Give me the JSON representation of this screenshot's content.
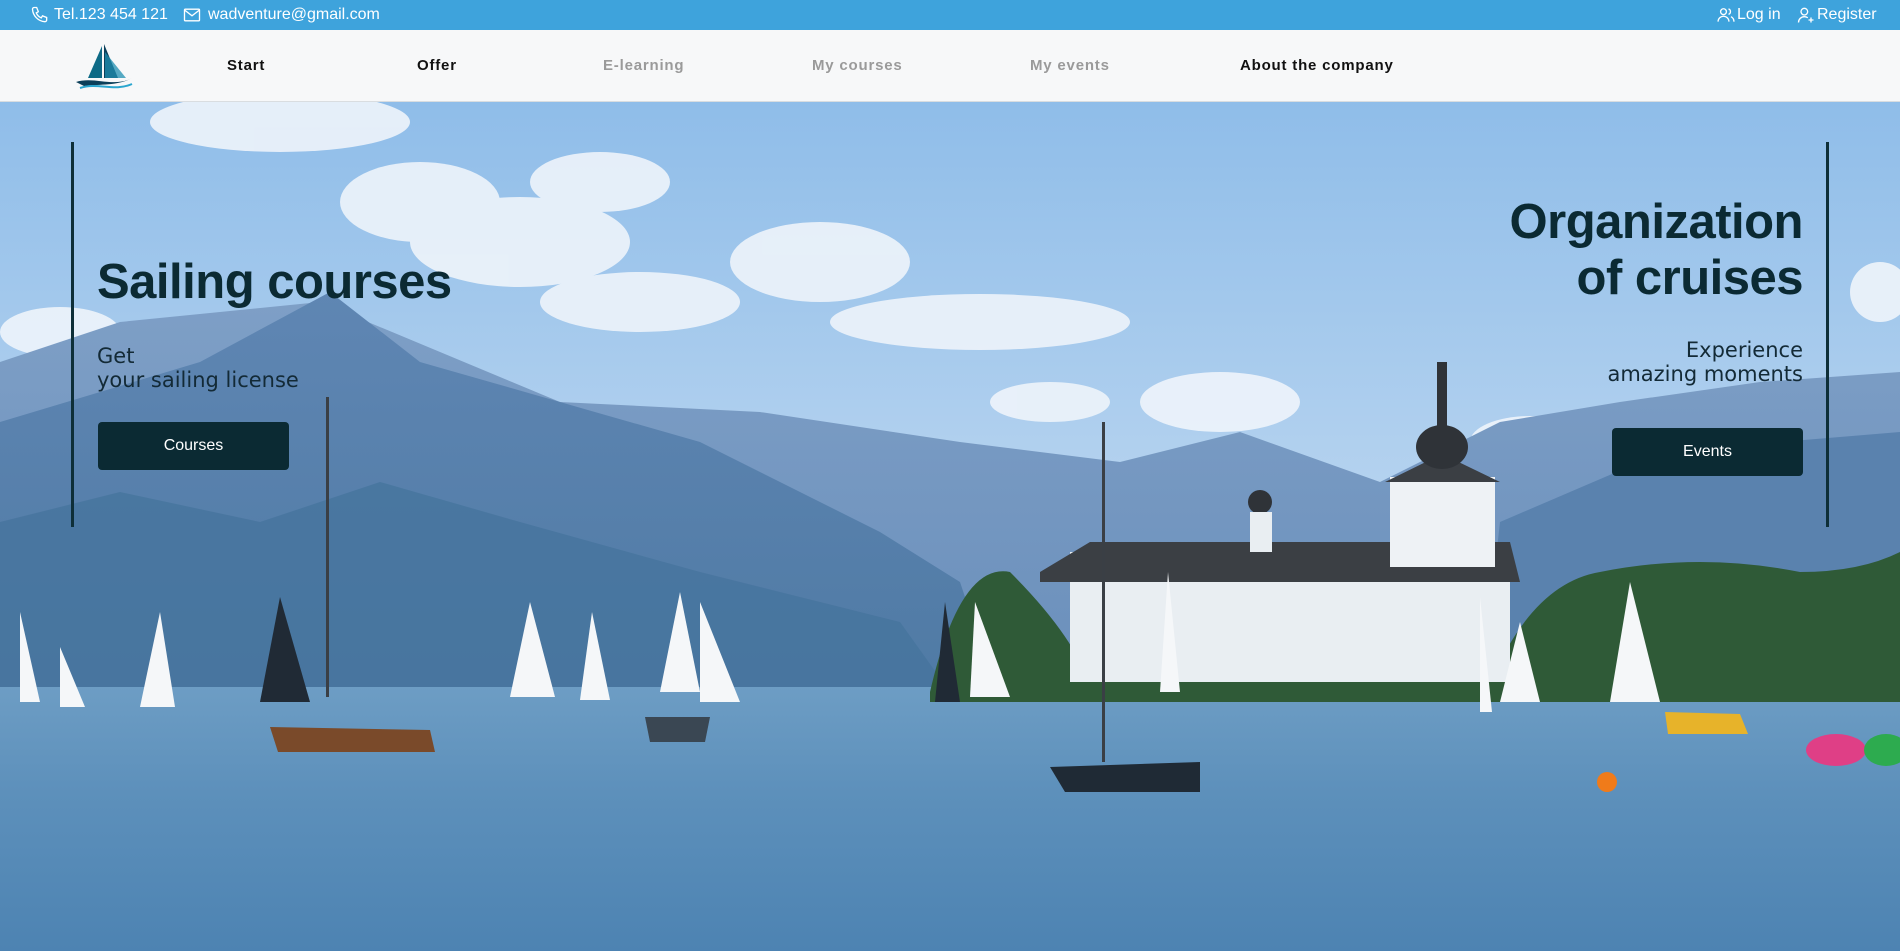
{
  "topbar": {
    "phone": "Tel.123 454 121",
    "email": "wadventure@gmail.com",
    "login": "Log in",
    "register": "Register"
  },
  "nav": {
    "items": [
      {
        "label": "Start"
      },
      {
        "label": "Offer"
      },
      {
        "label": "E-learning"
      },
      {
        "label": "My courses"
      },
      {
        "label": "My events"
      },
      {
        "label": "About the company"
      }
    ]
  },
  "hero": {
    "left": {
      "title": "Sailing courses",
      "subtitle_line1": "Get",
      "subtitle_line2": "your sailing license",
      "button": "Courses"
    },
    "right": {
      "title_line1": "Organization",
      "title_line2": "of cruises",
      "subtitle_line1": "Experience",
      "subtitle_line2": "amazing moments",
      "button": "Events"
    }
  },
  "colors": {
    "topbar": "#3ea3dc",
    "navbar": "#f7f8f9",
    "accent_dark": "#0b2a33"
  }
}
